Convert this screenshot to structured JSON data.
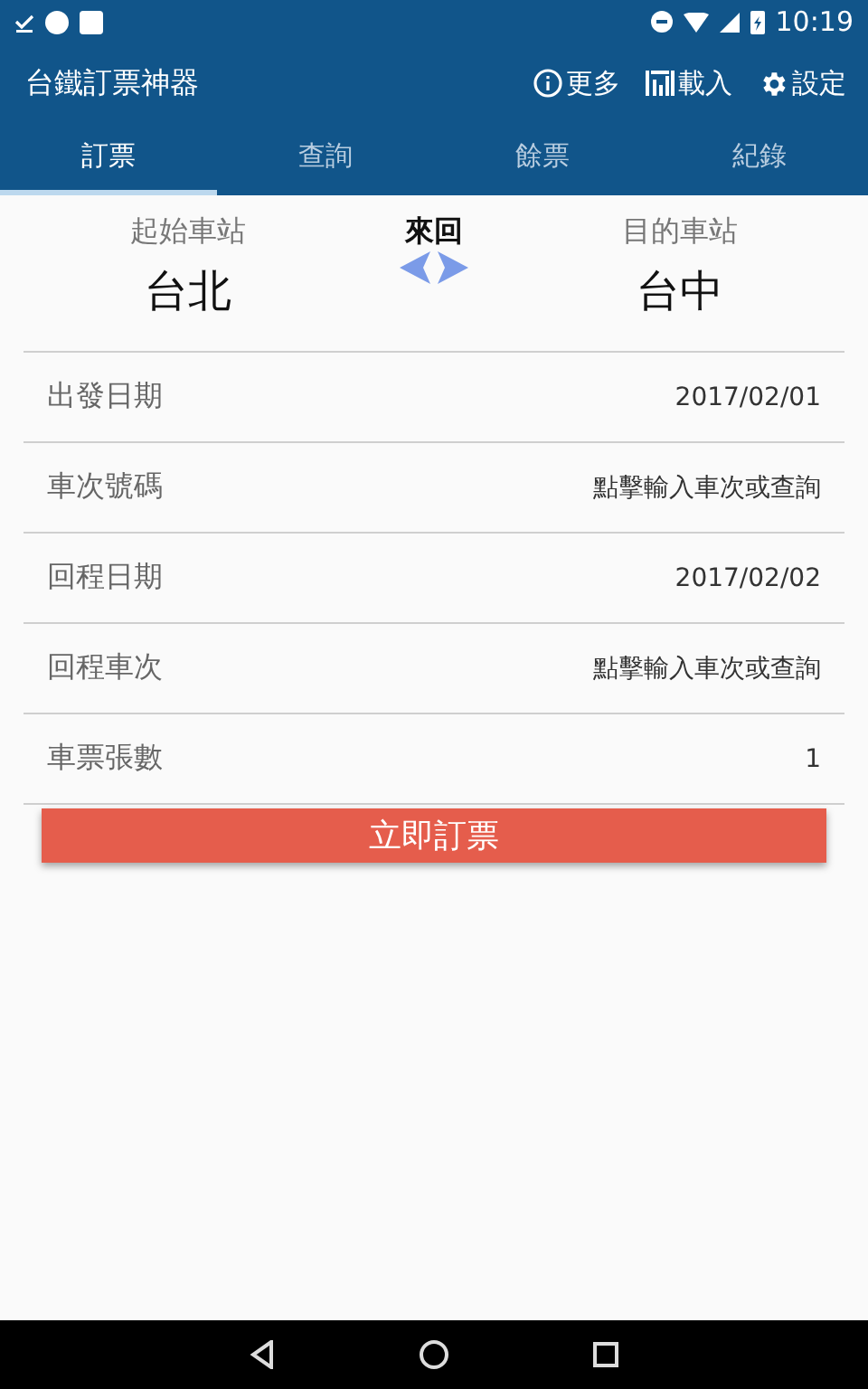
{
  "status_bar": {
    "time": "10:19"
  },
  "app_bar": {
    "title": "台鐵訂票神器",
    "actions": [
      {
        "kind": "info",
        "label": "更多"
      },
      {
        "kind": "chart",
        "label": "載入"
      },
      {
        "kind": "gear",
        "label": "設定"
      }
    ]
  },
  "tabs": [
    {
      "label": "訂票",
      "selected": true
    },
    {
      "label": "查詢",
      "selected": false
    },
    {
      "label": "餘票",
      "selected": false
    },
    {
      "label": "紀錄",
      "selected": false
    }
  ],
  "stations": {
    "from_label": "起始車站",
    "from": "台北",
    "trip_label": "來回",
    "to_label": "目的車站",
    "to": "台中"
  },
  "fields": [
    {
      "label": "出發日期",
      "value": "2017/02/01"
    },
    {
      "label": "車次號碼",
      "value": "點擊輸入車次或查詢"
    },
    {
      "label": "回程日期",
      "value": "2017/02/02"
    },
    {
      "label": "回程車次",
      "value": "點擊輸入車次或查詢"
    },
    {
      "label": "車票張數",
      "value": "1"
    }
  ],
  "book_button": "立即訂票"
}
